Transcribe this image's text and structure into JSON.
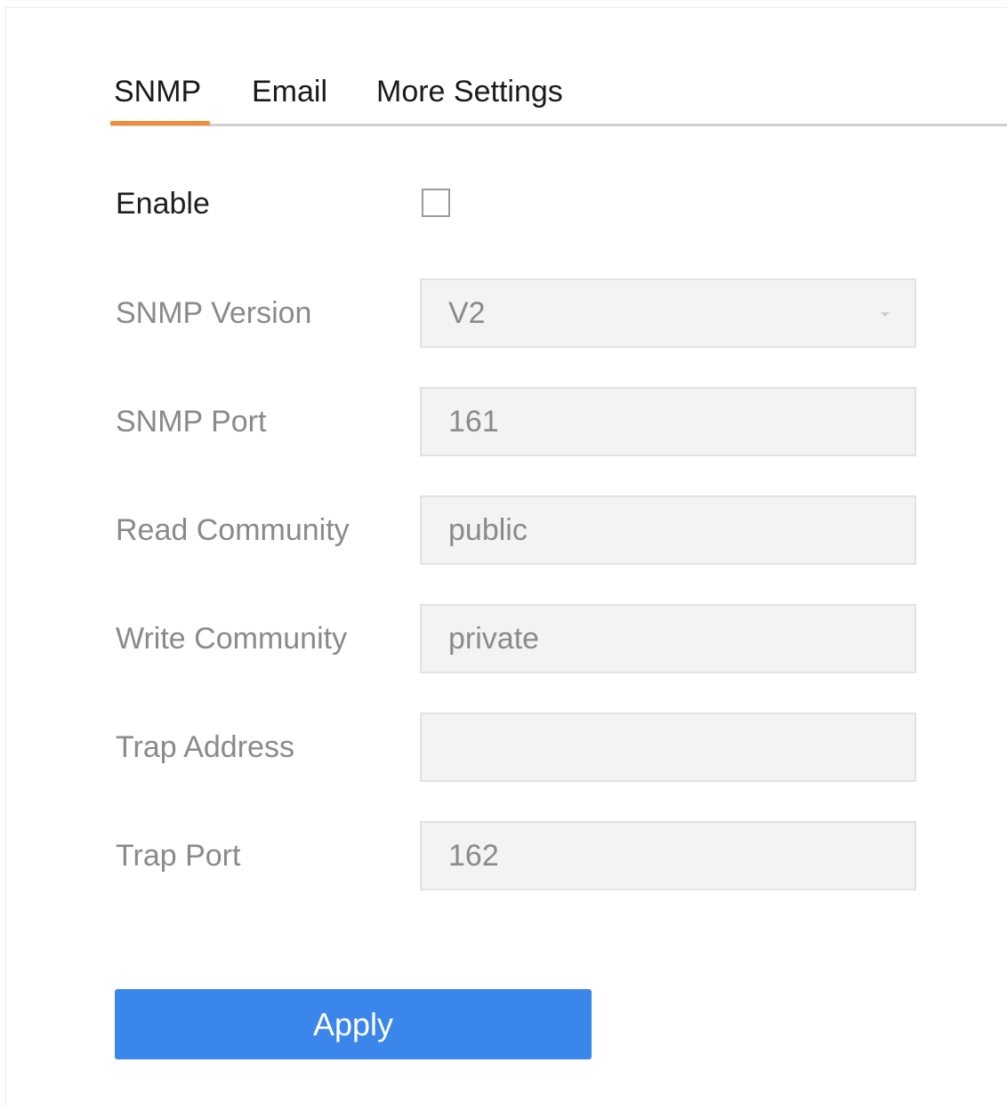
{
  "tabs": [
    {
      "label": "SNMP",
      "active": true
    },
    {
      "label": "Email",
      "active": false
    },
    {
      "label": "More Settings",
      "active": false
    }
  ],
  "accent_color": "#f28c38",
  "button_color": "#3b86ea",
  "form": {
    "enable": {
      "label": "Enable",
      "checked": false
    },
    "snmp_version": {
      "label": "SNMP Version",
      "value": "V2",
      "icon": "chevron-down-icon"
    },
    "snmp_port": {
      "label": "SNMP Port",
      "value": "161"
    },
    "read_community": {
      "label": "Read Community",
      "value": "public"
    },
    "write_community": {
      "label": "Write Community",
      "value": "private"
    },
    "trap_address": {
      "label": "Trap Address",
      "value": ""
    },
    "trap_port": {
      "label": "Trap Port",
      "value": "162"
    }
  },
  "apply_label": "Apply"
}
